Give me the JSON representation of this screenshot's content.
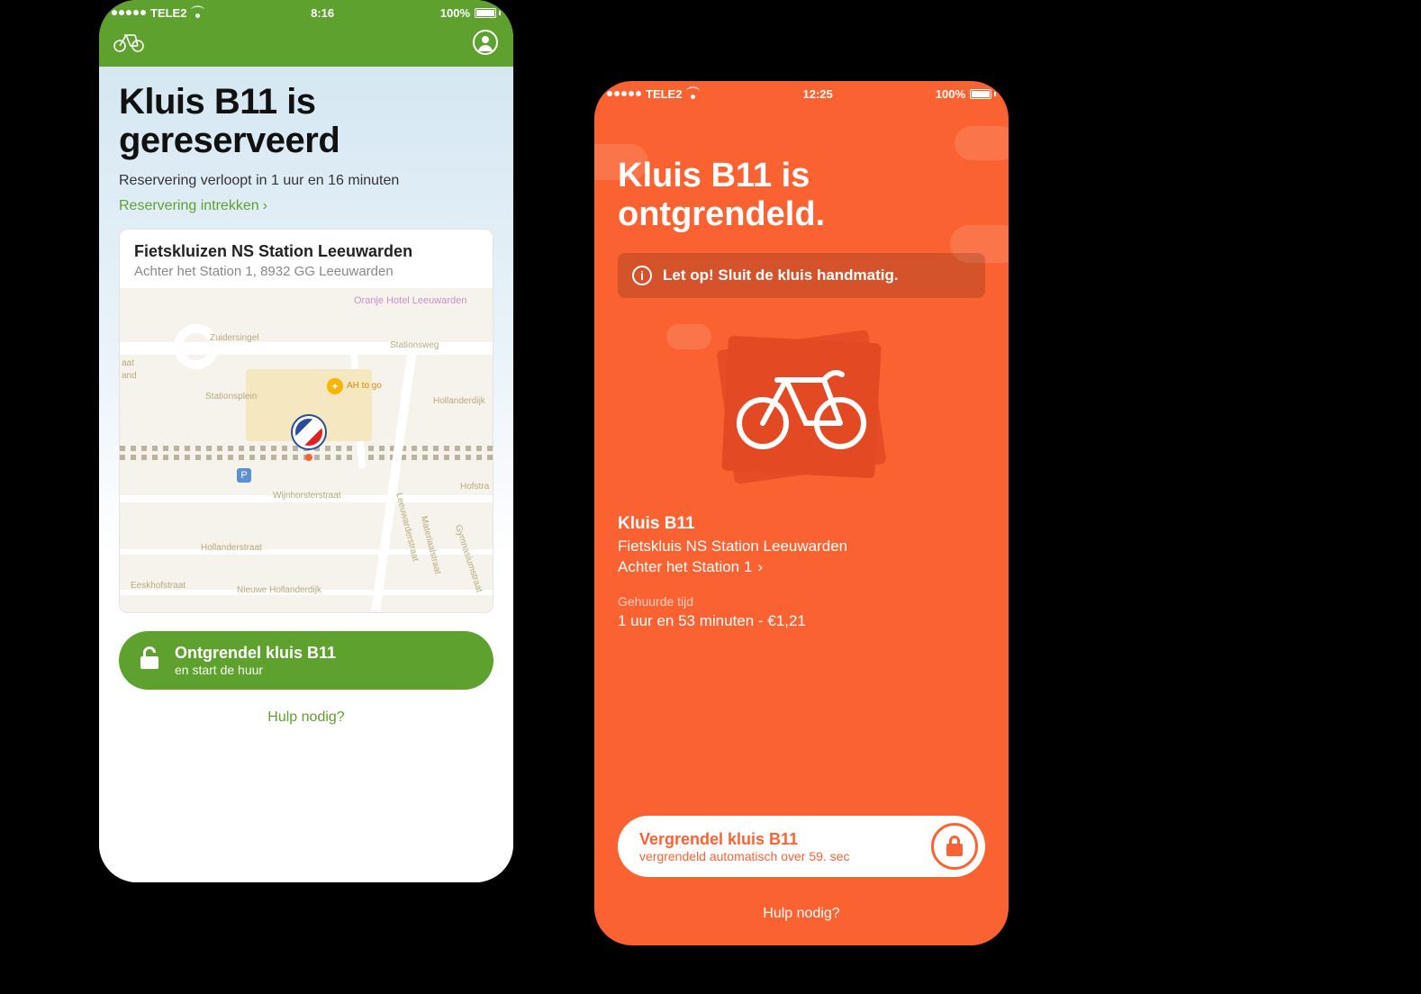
{
  "left": {
    "status": {
      "carrier": "TELE2",
      "time": "8:16",
      "battery": "100%"
    },
    "title": "Kluis B11 is gereserveerd",
    "subtitle": "Reservering verloopt in 1 uur en 16 minuten",
    "cancel_link": "Reservering intrekken",
    "location_card": {
      "title": "Fietskluizen NS Station Leeuwarden",
      "address": "Achter het Station 1, 8932 GG Leeuwarden",
      "map_labels": [
        "Zuidersingel",
        "Stationsplein",
        "Stationsweg",
        "Hollanderdijk",
        "Wijnhorsterstraat",
        "Hollanderstraat",
        "Nieuwe Hollanderdijk",
        "Eeskhofstraat",
        "Oranje Hotel Leeuwarden",
        "AH to go",
        "Hofstra",
        "Leeuwarderstraat",
        "Materiaalstraat",
        "Gymnasiumstraat",
        "aat",
        "and",
        "P"
      ]
    },
    "unlock_button": {
      "title": "Ontgrendel kluis B11",
      "subtitle": "en start de huur"
    },
    "help": "Hulp nodig?"
  },
  "right": {
    "status": {
      "carrier": "TELE2",
      "time": "12:25",
      "battery": "100%"
    },
    "title": "Kluis B11 is ontgrendeld.",
    "alert": "Let op! Sluit de kluis handmatig.",
    "info": {
      "name": "Kluis B11",
      "location": "Fietskluis NS Station Leeuwarden",
      "address": "Achter het Station 1",
      "time_label": "Gehuurde tijd",
      "time_value": "1 uur en 53 minuten - €1,21"
    },
    "lock_button": {
      "title": "Vergrendel kluis B11",
      "subtitle": "vergrendeld automatisch over 59. sec"
    },
    "help": "Hulp nodig?"
  },
  "colors": {
    "green": "#5EA12E",
    "orange": "#FB6232"
  }
}
